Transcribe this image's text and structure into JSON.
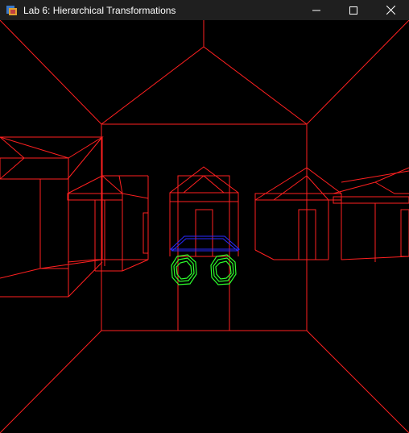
{
  "window": {
    "title": "Lab 6: Hierarchical Transformations",
    "controls": [
      "minimize",
      "maximize",
      "close"
    ]
  },
  "app_icon": "app-window-icon",
  "scene": {
    "background": "#000000",
    "colors": {
      "buildings": "#ff2020",
      "car_body": "#2a2aff",
      "wheels": "#2cff2c"
    }
  }
}
